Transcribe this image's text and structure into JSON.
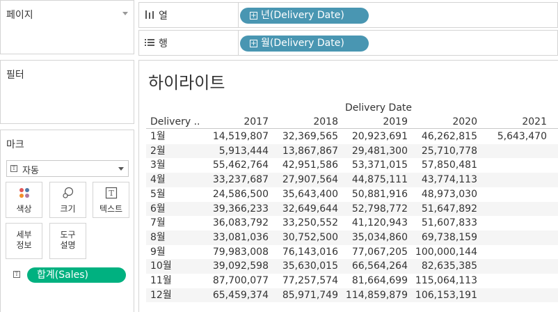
{
  "left_panel": {
    "pages_title": "페이지",
    "filters_title": "필터",
    "marks_title": "마크",
    "mark_type": "자동",
    "buttons": {
      "color": "색상",
      "size": "크기",
      "text": "텍스트",
      "detail": "세부\n정보",
      "tooltip": "도구\n설명"
    },
    "measure_pill": "합계(Sales)"
  },
  "shelves": {
    "columns_label": "열",
    "columns_pill": "년(Delivery Date)",
    "rows_label": "행",
    "rows_pill": "월(Delivery Date)"
  },
  "sheet": {
    "title": "하이라이트"
  },
  "chart_data": {
    "type": "table",
    "column_header": "Delivery Date",
    "row_header": "Delivery ..",
    "columns": [
      "2017",
      "2018",
      "2019",
      "2020",
      "2021"
    ],
    "rows": [
      {
        "label": "1월",
        "values": [
          "14,519,807",
          "32,369,565",
          "20,923,691",
          "46,262,815",
          "5,643,470"
        ]
      },
      {
        "label": "2월",
        "values": [
          "5,913,444",
          "13,867,867",
          "29,481,300",
          "25,710,778",
          ""
        ]
      },
      {
        "label": "3월",
        "values": [
          "55,462,764",
          "42,951,586",
          "53,371,015",
          "57,850,481",
          ""
        ]
      },
      {
        "label": "4월",
        "values": [
          "33,237,687",
          "27,907,564",
          "44,875,111",
          "43,774,113",
          ""
        ]
      },
      {
        "label": "5월",
        "values": [
          "24,586,500",
          "35,643,400",
          "50,881,916",
          "48,973,030",
          ""
        ]
      },
      {
        "label": "6월",
        "values": [
          "39,366,233",
          "32,649,644",
          "52,798,772",
          "51,647,892",
          ""
        ]
      },
      {
        "label": "7월",
        "values": [
          "36,083,792",
          "33,250,552",
          "41,120,943",
          "51,607,833",
          ""
        ]
      },
      {
        "label": "8월",
        "values": [
          "33,081,036",
          "30,752,500",
          "35,034,860",
          "69,738,159",
          ""
        ]
      },
      {
        "label": "9월",
        "values": [
          "79,983,008",
          "76,143,016",
          "77,067,205",
          "100,000,144",
          ""
        ]
      },
      {
        "label": "10월",
        "values": [
          "39,092,598",
          "35,630,015",
          "66,564,264",
          "82,635,385",
          ""
        ]
      },
      {
        "label": "11월",
        "values": [
          "87,700,077",
          "77,257,574",
          "81,664,699",
          "115,064,113",
          ""
        ]
      },
      {
        "label": "12월",
        "values": [
          "65,459,374",
          "85,971,749",
          "114,859,879",
          "106,153,191",
          ""
        ]
      }
    ]
  }
}
